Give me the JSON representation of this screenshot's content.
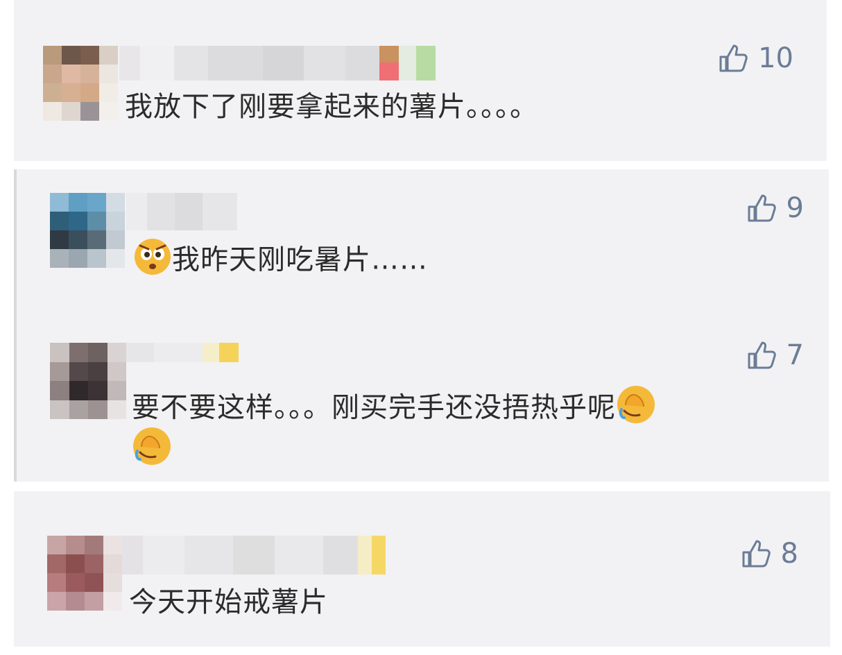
{
  "comments": [
    {
      "likes": "10",
      "text": "我放下了刚要拿起来的薯片。。。。",
      "avatar_colors": [
        "#b99a7a",
        "#6d564a",
        "#7c5e4e",
        "#d9cfc4",
        "#c9a68c",
        "#e0b9a5",
        "#d7b29a",
        "#ece6e1",
        "#cdb091",
        "#d7af92",
        "#d4a988",
        "#f2ece6",
        "#efe8e3",
        "#ded6cf",
        "#9a9296",
        "#f3efec"
      ]
    },
    {
      "likes": "9",
      "text": "我昨天刚吃暑片……",
      "emoji": "face-emoji",
      "avatar_colors": [
        "#8fbbd6",
        "#5f9fc3",
        "#6aa6c9",
        "#d3dce3",
        "#2f5e79",
        "#2e6787",
        "#5c8ea8",
        "#c9d3db",
        "#2f3a44",
        "#3a4e5c",
        "#5a6b78",
        "#c2cad1",
        "#a9b2b9",
        "#9aa6b0",
        "#b9c4cd",
        "#e4e7ea"
      ]
    },
    {
      "likes": "7",
      "text_line1": "要不要这样。。。刚买完手还没捂热乎呢",
      "emoji": "facepalm-emoji",
      "avatar_colors": [
        "#c9c2c0",
        "#7d6f6e",
        "#6d6260",
        "#d9d4d3",
        "#a69a98",
        "#54484a",
        "#4a3f41",
        "#cfc8c6",
        "#8d8080",
        "#2f292b",
        "#3b3335",
        "#c1b9b8",
        "#c9c3c2",
        "#aaa1a1",
        "#9c9291",
        "#e7e3e2"
      ]
    },
    {
      "likes": "8",
      "text": "今天开始戒薯片",
      "avatar_colors": [
        "#c8a5a5",
        "#b68c8c",
        "#a37a7a",
        "#ebe2e2",
        "#a26767",
        "#8c4f50",
        "#9b6364",
        "#e4dada",
        "#b77c7e",
        "#9b5b5e",
        "#8f5356",
        "#e6dddd",
        "#caa4a8",
        "#b48b90",
        "#c39ea2",
        "#f0eaea"
      ]
    }
  ],
  "colors": {
    "card_bg": "#f2f2f4",
    "like_color": "#6b7c96",
    "text_color": "#2b2b2b"
  }
}
